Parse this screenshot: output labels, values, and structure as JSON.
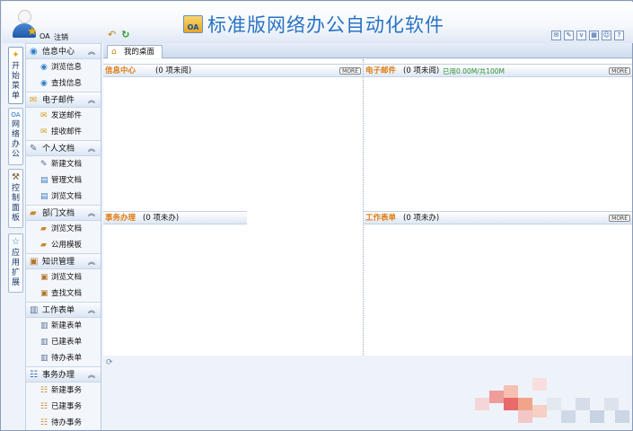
{
  "header": {
    "app_title": "标准版网络办公自动化软件",
    "logo_text": "OA",
    "user_name": "OA",
    "logout_label": "注销",
    "accent_color": "#2a73c4",
    "nav_icons": [
      "back-icon",
      "refresh-icon"
    ],
    "tool_icons": [
      "help-icon",
      "edit-icon",
      "v-icon",
      "calendar-icon",
      "person-icon",
      "question-icon"
    ]
  },
  "vertical_tabs": [
    {
      "label": "开始菜单",
      "icon": "star-bulb-icon"
    },
    {
      "label": "网络办公",
      "icon": "oa-icon"
    },
    {
      "label": "控制面板",
      "icon": "wrench-icon"
    },
    {
      "label": "应用扩展",
      "icon": "star-icon"
    }
  ],
  "sidebar": {
    "groups": [
      {
        "label": "信息中心",
        "icon": "globe-icon",
        "items": [
          {
            "label": "浏览信息",
            "icon": "globe-icon"
          },
          {
            "label": "查找信息",
            "icon": "globe-icon"
          }
        ]
      },
      {
        "label": "电子邮件",
        "icon": "mail-icon",
        "items": [
          {
            "label": "发送邮件",
            "icon": "mail-icon"
          },
          {
            "label": "接收邮件",
            "icon": "mail-icon"
          }
        ]
      },
      {
        "label": "个人文档",
        "icon": "pen-icon",
        "items": [
          {
            "label": "新建文档",
            "icon": "pen-icon"
          },
          {
            "label": "管理文档",
            "icon": "document-icon"
          },
          {
            "label": "浏览文档",
            "icon": "document-icon"
          }
        ]
      },
      {
        "label": "部门文档",
        "icon": "folder-icon",
        "items": [
          {
            "label": "浏览文档",
            "icon": "folder-icon"
          },
          {
            "label": "公用模板",
            "icon": "folder-icon"
          }
        ]
      },
      {
        "label": "知识管理",
        "icon": "book-icon",
        "items": [
          {
            "label": "浏览文档",
            "icon": "book-icon"
          },
          {
            "label": "查找文档",
            "icon": "book-icon"
          }
        ]
      },
      {
        "label": "工作表单",
        "icon": "form-icon",
        "items": [
          {
            "label": "新建表单",
            "icon": "form-icon"
          },
          {
            "label": "已建表单",
            "icon": "form-icon"
          },
          {
            "label": "待办表单",
            "icon": "form-icon"
          }
        ]
      },
      {
        "label": "事务办理",
        "icon": "task-icon",
        "items": [
          {
            "label": "新建事务",
            "icon": "task-icon"
          },
          {
            "label": "已建事务",
            "icon": "task-icon"
          },
          {
            "label": "待办事务",
            "icon": "task-icon"
          }
        ]
      }
    ]
  },
  "tabs": {
    "home_label": "我的桌面"
  },
  "panels": {
    "info": {
      "title": "信息中心",
      "count_text": "(0 项未阅)",
      "more_label": "MORE"
    },
    "mail": {
      "title": "电子邮件",
      "count_text": "(0 项未阅)",
      "quota_text": "已用0.00M/共100M",
      "more_label": "MORE"
    },
    "task": {
      "title": "事务办理",
      "count_text": "(0 项未办)"
    },
    "form": {
      "title": "工作表单",
      "count_text": "(0 项未办)",
      "more_label": "MORE"
    }
  }
}
